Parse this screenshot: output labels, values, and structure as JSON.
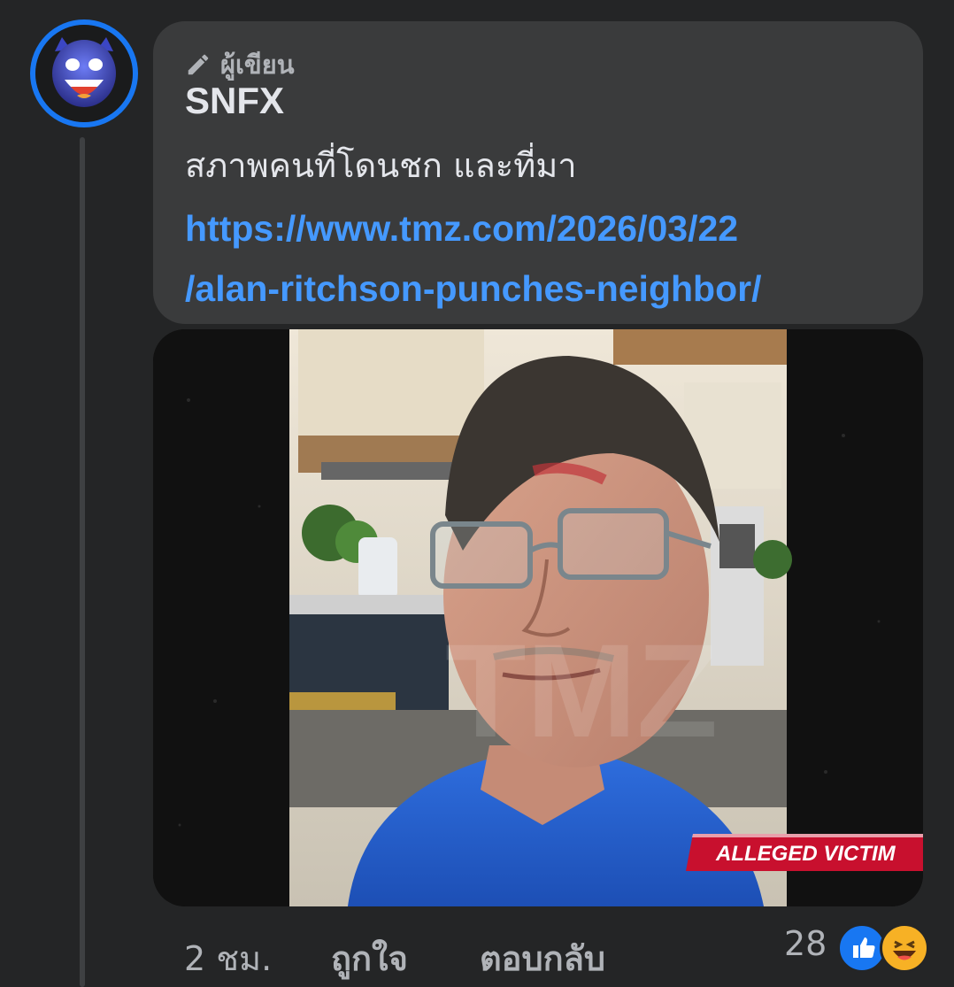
{
  "comment": {
    "author_badge": "ผู้เขียน",
    "author_name": "SNFX",
    "text": "สภาพคนที่โดนชก และที่มา",
    "link_line1": "https://www.tmz.com/2026/03/22",
    "link_line2": "/alan-ritchson-punches-neighbor/",
    "image": {
      "caption_tag": "ALLEGED VICTIM",
      "watermark": "TMZ"
    },
    "footer": {
      "time": "2 ชม.",
      "like_label": "ถูกใจ",
      "reply_label": "ตอบกลับ",
      "reaction_count": "28",
      "reactions": [
        "like-icon",
        "haha-icon"
      ]
    }
  },
  "colors": {
    "background": "#242526",
    "bubble": "#3a3b3c",
    "link": "#4599ff",
    "avatar_ring": "#1877f2",
    "tag_red": "#c8102e"
  }
}
